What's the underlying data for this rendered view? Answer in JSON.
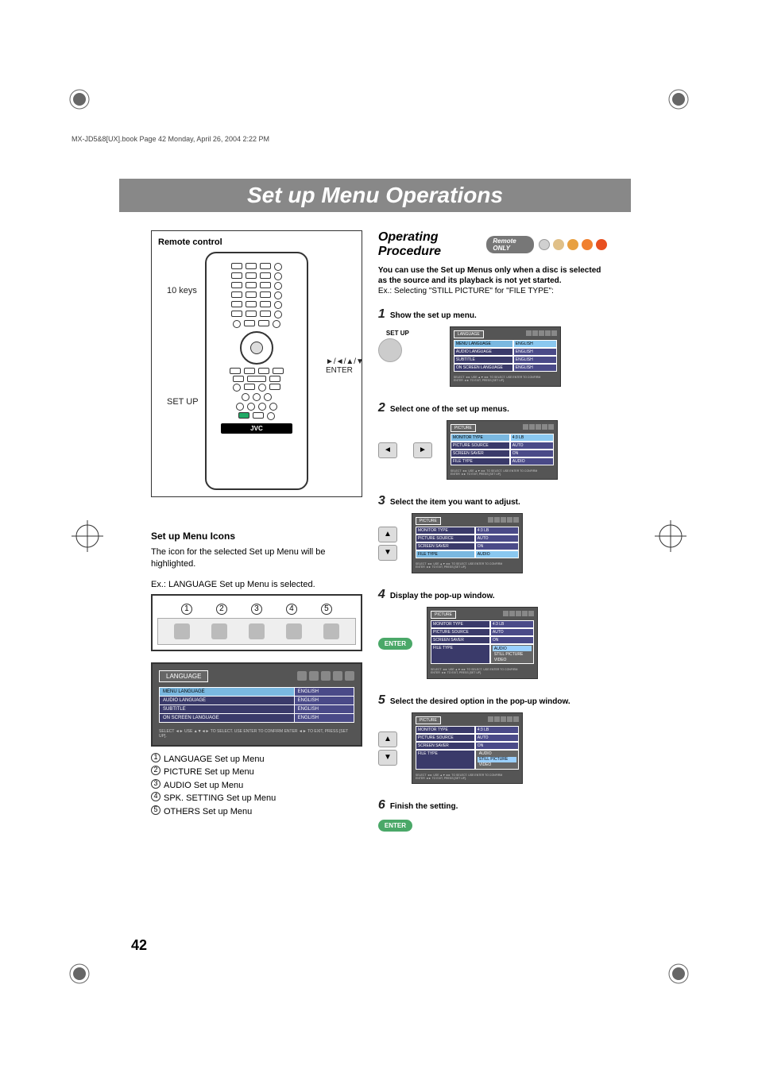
{
  "header_line": "MX-JD5&8[UX].book  Page 42  Monday, April 26, 2004  2:22 PM",
  "page_title": "Set up Menu Operations",
  "page_number": "42",
  "remote": {
    "box_title": "Remote control",
    "label_10keys": "10 keys",
    "label_setup": "SET UP",
    "label_enter_arrows": "►/◄/▲/▼",
    "label_enter": "ENTER",
    "brand": "JVC"
  },
  "icons_section": {
    "heading": "Set up Menu Icons",
    "description": "The icon for the selected Set up Menu will be highlighted.",
    "example_label": "Ex.: LANGUAGE Set up Menu is selected.",
    "circled": [
      "1",
      "2",
      "3",
      "4",
      "5"
    ],
    "osd_language": {
      "menu_name": "LANGUAGE",
      "rows": [
        {
          "key": "MENU LANGUAGE",
          "val": "ENGLISH",
          "hi": true
        },
        {
          "key": "AUDIO LANGUAGE",
          "val": "ENGLISH",
          "hi": false
        },
        {
          "key": "SUBTITLE",
          "val": "ENGLISH",
          "hi": false
        },
        {
          "key": "ON SCREEN LANGUAGE",
          "val": "ENGLISH",
          "hi": false
        }
      ],
      "footer": "SELECT ◄► USE ▲▼◄► TO SELECT. USE ENTER TO CONFIRM\nENTER ◄► TO EXIT, PRESS [SET UP]."
    },
    "legend": [
      "LANGUAGE Set up Menu",
      "PICTURE Set up Menu",
      "AUDIO Set up Menu",
      "SPK. SETTING Set up Menu",
      "OTHERS Set up Menu"
    ]
  },
  "operating": {
    "heading": "Operating Procedure",
    "badge": "Remote ONLY",
    "intro_bold": "You can use the Set up Menus only when a disc is selected as the source and its playback is not yet started.",
    "intro_ex": "Ex.: Selecting \"STILL PICTURE\" for \"FILE TYPE\":",
    "steps": [
      {
        "num": "1",
        "text": "Show the set up menu.",
        "setup_label": "SET UP"
      },
      {
        "num": "2",
        "text": "Select one of the set up menus."
      },
      {
        "num": "3",
        "text": "Select the item you want to adjust."
      },
      {
        "num": "4",
        "text": "Display the pop-up window.",
        "enter": "ENTER"
      },
      {
        "num": "5",
        "text": "Select the desired option in the pop-up window."
      },
      {
        "num": "6",
        "text": "Finish the setting.",
        "enter": "ENTER"
      }
    ],
    "osd_picture": {
      "menu_name": "PICTURE",
      "rows": [
        {
          "key": "MONITOR TYPE",
          "val": "4:3 LB"
        },
        {
          "key": "PICTURE SOURCE",
          "val": "AUTO"
        },
        {
          "key": "SCREEN SAVER",
          "val": "ON"
        },
        {
          "key": "FILE TYPE",
          "val": "AUDIO"
        }
      ],
      "footer1": "SELECT ◄► USE ▲▼◄► TO SELECT. USE ENTER TO CONFIRM",
      "footer2": "ENTER ◄► TO EXIT, PRESS [SET UP].",
      "popup_options": [
        "AUDIO",
        "STILL PICTURE",
        "VIDEO"
      ]
    }
  }
}
